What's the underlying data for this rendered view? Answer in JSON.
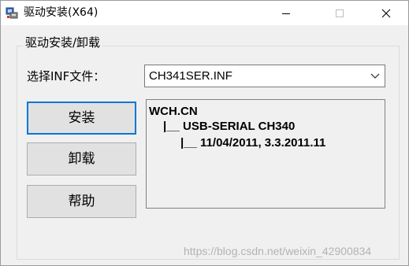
{
  "window": {
    "title": "驱动安装(X64)",
    "controls": [
      "minimize-icon",
      "maximize-icon",
      "close-icon"
    ]
  },
  "group": {
    "title": "驱动安装/卸载",
    "inf_label": "选择INF文件：",
    "inf_selected": "CH341SER.INF",
    "buttons": {
      "install": "安装",
      "uninstall": "卸载",
      "help": "帮助"
    },
    "info_lines": [
      "WCH.CN",
      "|__ USB-SERIAL CH340",
      "|__ 11/04/2011, 3.3.2011.11"
    ]
  },
  "watermark": "https://blog.csdn.net/weixin_42900834",
  "colors": {
    "focus_border": "#0078d7",
    "window_bg": "#f0f0f0",
    "button_bg": "#e1e1e1"
  }
}
